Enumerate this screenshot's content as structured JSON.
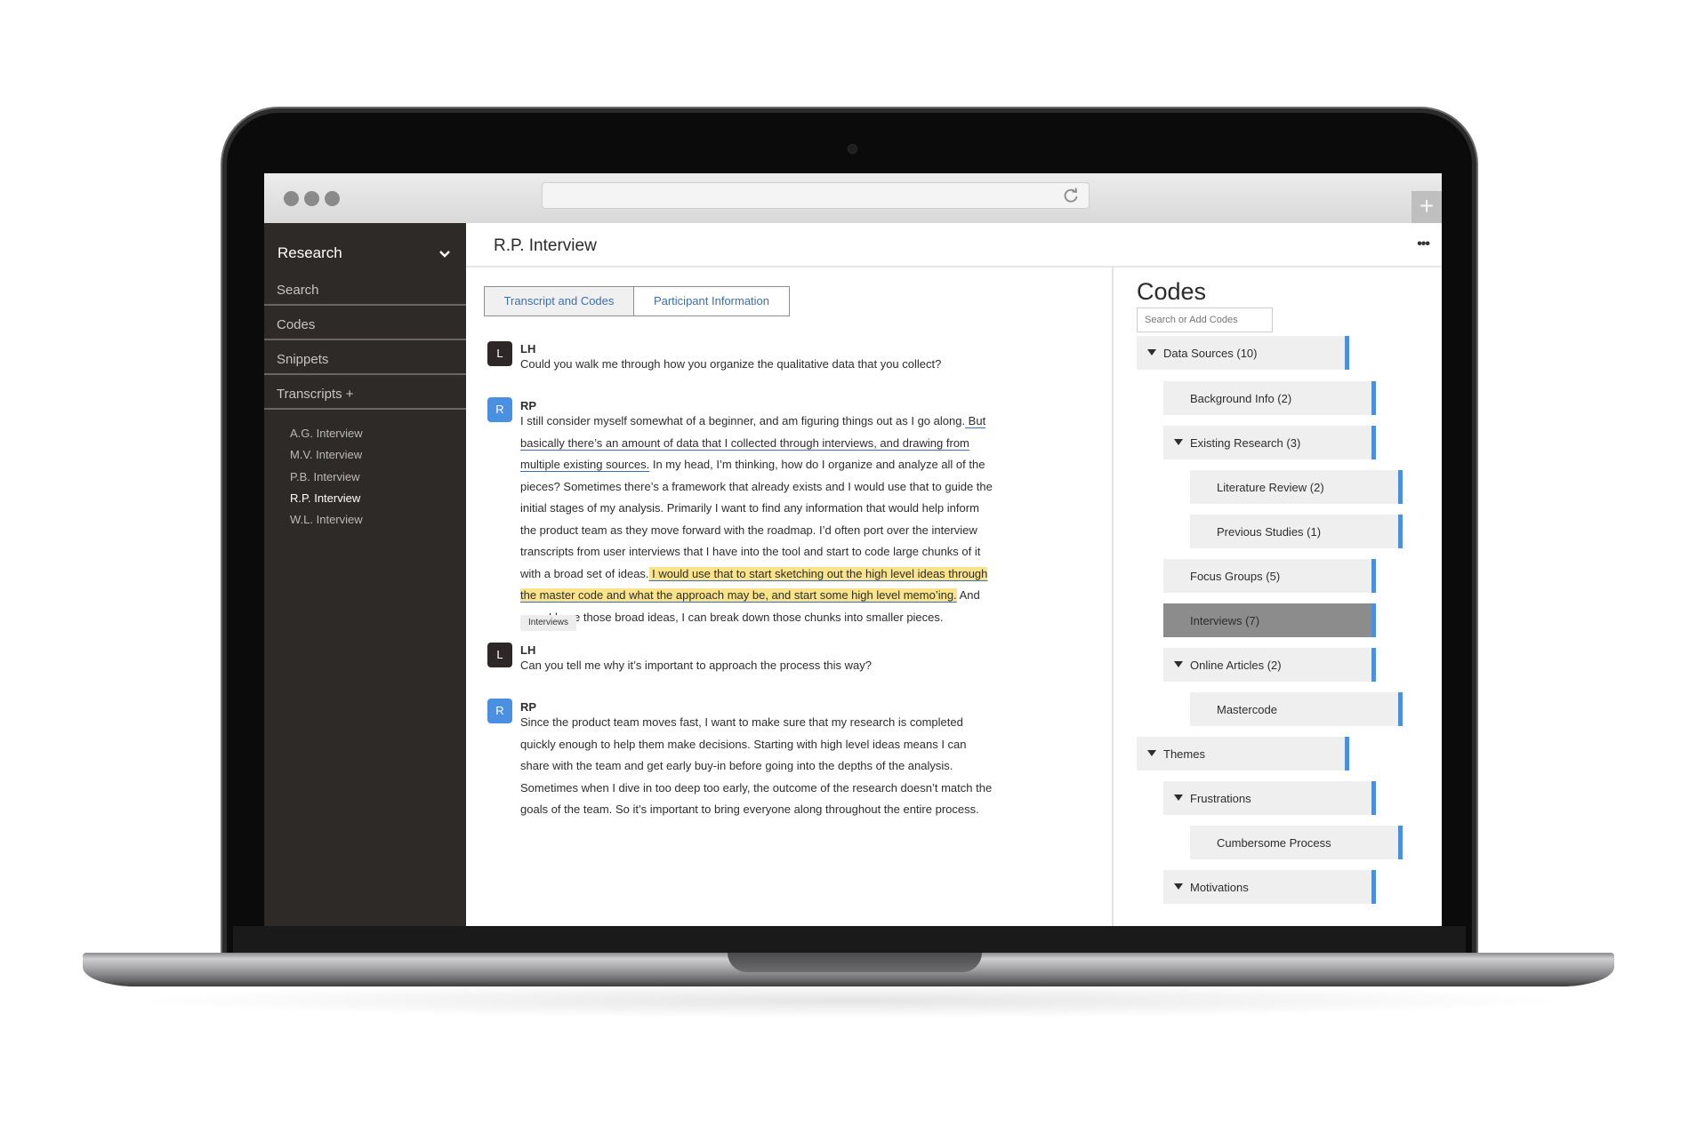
{
  "browser": {
    "new_tab_label": "+"
  },
  "sidebar": {
    "workspace": "Research",
    "nav": [
      "Search",
      "Codes",
      "Snippets",
      "Transcripts +"
    ],
    "transcripts": [
      "A.G. Interview",
      "M.V. Interview",
      "P.B. Interview",
      "R.P. Interview",
      "W.L. Interview"
    ],
    "active_transcript": "R.P. Interview"
  },
  "header": {
    "title": "R.P. Interview",
    "more": "•••"
  },
  "tabs": [
    "Transcript and Codes",
    "Participant Information"
  ],
  "transcript": {
    "q1": {
      "avatar": "L",
      "speaker": "LH",
      "text": "Could you walk me through how you organize the qualitative data that you collect?"
    },
    "a1": {
      "avatar": "R",
      "speaker": "RP",
      "p1": "I still consider myself somewhat of a beginner, and am figuring things out as I go along.",
      "u1": " But basically there’s an amount of data that I collected through interviews, and drawing from multiple existing sources.",
      "p2": " In my head, I’m thinking, how do I organize and analyze all of the pieces? Sometimes there’s a framework that already exists and I would use that to guide the initial stages of my analysis. Primarily I want to find any information that would help inform the product team as they move forward with the roadmap. I’d often port over the interview transcripts from user interviews that I have into the tool and start to code large chunks of it with a broad set of ideas.",
      "h1": " I would use that to start sketching out the high level ideas through the master code and what the approach may be, and start some high level memo’ing.",
      "p3": " And once I have those broad ideas, I can break down those chunks into smaller pieces.",
      "tag": "Interviews"
    },
    "q2": {
      "avatar": "L",
      "speaker": "LH",
      "text": "Can you tell me why it’s important to approach the process this way?"
    },
    "a2": {
      "avatar": "R",
      "speaker": "RP",
      "text": "Since the product team moves fast, I want to make sure that my research is completed quickly enough to help them make decisions. Starting with high level ideas means I can share with the team and get early buy-in before going into the depths of the analysis. Sometimes when I dive in too deep too early, the outcome of the research doesn’t match the goals of the team. So it’s important to bring everyone along throughout the entire process."
    }
  },
  "codes": {
    "title": "Codes",
    "search_placeholder": "Search or Add Codes",
    "items": [
      {
        "label": "Data Sources (10)",
        "expanded": true
      },
      {
        "label": "Background Info (2)"
      },
      {
        "label": "Existing Research (3)",
        "expanded": true
      },
      {
        "label": "Literature Review (2)"
      },
      {
        "label": "Previous Studies (1)"
      },
      {
        "label": "Focus Groups (5)"
      },
      {
        "label": "Interviews (7)",
        "selected": true
      },
      {
        "label": "Online Articles (2)",
        "expanded": true
      },
      {
        "label": "Mastercode"
      },
      {
        "label": "Themes",
        "expanded": true
      },
      {
        "label": "Frustrations",
        "expanded": true
      },
      {
        "label": "Cumbersome Process"
      },
      {
        "label": "Motivations",
        "expanded": true
      }
    ],
    "accent": "#4a8fe0",
    "selected_color": "#8c8c8c"
  },
  "colors": {
    "sidebar": "#2e2a28",
    "highlight": "#fbe38a",
    "link": "#3a6fb6",
    "avatar_blue": "#4a90e2"
  }
}
